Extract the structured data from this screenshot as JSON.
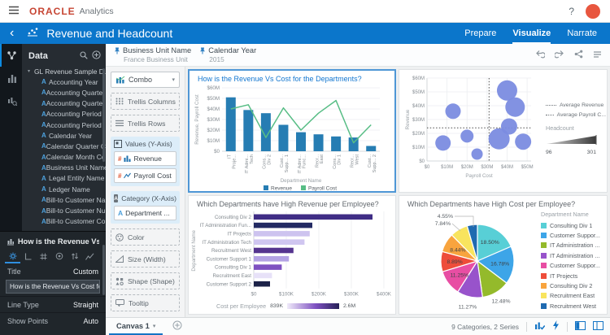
{
  "app_bar": {
    "brand": "ORACLE",
    "product": "Analytics",
    "help_label": "?"
  },
  "title_bar": {
    "title": "Revenue and Headcount",
    "tabs": [
      {
        "label": "Prepare"
      },
      {
        "label": "Visualize"
      },
      {
        "label": "Narrate"
      }
    ]
  },
  "data_panel": {
    "title": "Data",
    "dataset": "GL Revenue Sample D...",
    "fields": [
      "Accounting Year",
      "Accounting Quarter ...",
      "Accounting Quarter ...",
      "Accounting Period ...",
      "Accounting Period ...",
      "Calendar Year",
      "Calendar Quarter C...",
      "Calendar Month Co...",
      "Business Unit Name",
      "Legal Entity Name",
      "Ledger Name",
      "Bill-to Customer Na...",
      "Bill-to Customer Nu...",
      "Bill-to Customer Co..."
    ]
  },
  "properties_panel": {
    "title": "How is the Revenue Vs Co...",
    "title_label": "Title",
    "title_value": "Custom",
    "title_input": "How is the Revenue Vs Cost for the",
    "line_type_label": "Line Type",
    "line_type_value": "Straight",
    "show_points_label": "Show Points",
    "show_points_value": "Auto"
  },
  "filters": [
    {
      "name": "Business Unit Name",
      "value": "France Business Unit"
    },
    {
      "name": "Calendar Year",
      "value": "2015"
    }
  ],
  "grammar_panel": {
    "chart_type": "Combo",
    "trellis_columns": "Trellis Columns",
    "trellis_rows": "Trellis Rows",
    "values_label": "Values (Y-Axis)",
    "value_items": [
      "Revenue",
      "Payroll Cost"
    ],
    "category_label": "Category (X-Axis)",
    "category_item": "Department ...",
    "extra_zones": [
      "Color",
      "Size (Width)",
      "Shape (Shape)",
      "Tooltip"
    ]
  },
  "status_bar": {
    "canvas_tab": "Canvas 1",
    "summary": "9 Categories, 2 Series"
  },
  "colors": {
    "accent_blue": "#0b76cb",
    "oracle_red": "#c74634",
    "selected_tile_border": "#4f97d6",
    "bar_revenue": "#267db3",
    "line_payroll": "#57bd85",
    "bubble": "#7b8ce0"
  },
  "chart_data": [
    {
      "type": "combo",
      "title": "How is the Revenue Vs Cost for the Departments?",
      "categories": [
        [
          "IT",
          "Proje..."
        ],
        [
          "IT Admi...",
          "Tech"
        ],
        [
          "Cons...",
          "Div 2"
        ],
        [
          "Cust...",
          "Supp... 1"
        ],
        [
          "IT Admi...",
          "Func..."
        ],
        [
          "Recr...",
          "East"
        ],
        [
          "Cons...",
          "Div 1"
        ],
        [
          "Recr...",
          "West"
        ],
        [
          "Cust...",
          "Supp... 2"
        ]
      ],
      "series": [
        {
          "name": "Revenue",
          "type": "bar",
          "color": "#267db3",
          "values_m": [
            51,
            39,
            36,
            25,
            18,
            16,
            14,
            13,
            5
          ]
        },
        {
          "name": "Payroll Cost",
          "type": "line",
          "color": "#57bd85",
          "values_m": [
            40,
            44,
            13,
            41,
            20,
            36,
            48,
            8,
            25
          ]
        }
      ],
      "xlabel": "Department Name",
      "ylabel": "Revenue, Payroll Cost",
      "yticks": [
        "$0",
        "$10M",
        "$20M",
        "$30M",
        "$40M",
        "$50M",
        "$60M"
      ],
      "ylim": [
        0,
        60
      ]
    },
    {
      "type": "scatter",
      "points": [
        {
          "x": 40,
          "y": 51,
          "r": 12.5
        },
        {
          "x": 44,
          "y": 39,
          "r": 12
        },
        {
          "x": 13,
          "y": 36,
          "r": 9.5
        },
        {
          "x": 41,
          "y": 25,
          "r": 10
        },
        {
          "x": 20,
          "y": 18,
          "r": 8
        },
        {
          "x": 36,
          "y": 16,
          "r": 13
        },
        {
          "x": 48,
          "y": 14,
          "r": 10
        },
        {
          "x": 8,
          "y": 13,
          "r": 9.5
        },
        {
          "x": 25,
          "y": 5,
          "r": 7
        }
      ],
      "color": "#7b8ce0",
      "xlabel": "Payroll Cost",
      "ylabel": "Revenue",
      "xticks": [
        "$0",
        "$10M",
        "$20M",
        "$30M",
        "$40M",
        "$50M"
      ],
      "yticks": [
        "$0",
        "$10M",
        "$20M",
        "$30M",
        "$40M",
        "$50M",
        "$60M"
      ],
      "xlim": [
        0,
        52
      ],
      "ylim": [
        0,
        60
      ],
      "avg_revenue": 24,
      "avg_payroll": 31,
      "legend": [
        "Average Revenue",
        "Average Payroll C..."
      ],
      "size_legend": {
        "title": "Headcount",
        "min": "96",
        "max": "301"
      }
    },
    {
      "type": "bar-horizontal",
      "title": "Which Departments have High Revenue per Employee?",
      "categories": [
        "Consulting Div 2",
        "IT Administration Fun...",
        "IT Projects",
        "IT Administration Tech",
        "Recruitment West",
        "Customer Support 1",
        "Consulting Div 1",
        "Recruitment East",
        "Customer Support 2"
      ],
      "values_k": [
        365,
        180,
        172,
        156,
        122,
        108,
        86,
        56,
        50
      ],
      "colors": [
        "#3f2d85",
        "#232a63",
        "#cdc3ef",
        "#d0c6f0",
        "#55348f",
        "#b3a2e4",
        "#7e51c1",
        "#e7e1f8",
        "#1c2248"
      ],
      "xlabel": "Revenue per Employee",
      "ylabel": "Department Name",
      "xticks": [
        "$0",
        "$100K",
        "$200K",
        "$300K",
        "$400K"
      ],
      "xlim": [
        0,
        400
      ],
      "gradient_legend": {
        "title": "Cost per Employee",
        "min": "839K",
        "max": "2.6M",
        "from": "#f0ebfa",
        "mid": "#7e51c1",
        "to": "#262057"
      }
    },
    {
      "type": "pie",
      "title": "Which Departments have High Cost per Employee?",
      "legend_title": "Department Name",
      "slices": [
        {
          "label": "Consulting Div 1",
          "pct": 18.5,
          "display": "18.50%",
          "color": "#58cfd6",
          "label_pos": "in"
        },
        {
          "label": "Customer Suppor...",
          "pct": 16.78,
          "display": "16.78%",
          "color": "#3da5e8",
          "label_pos": "in"
        },
        {
          "label": "IT Administration ...",
          "pct": 12.48,
          "display": "12.48%",
          "color": "#94ba2b",
          "label_pos": "out"
        },
        {
          "label": "IT Administration ...",
          "pct": 11.27,
          "display": "11.27%",
          "color": "#9853cb",
          "label_pos": "out"
        },
        {
          "label": "Customer Suppor...",
          "pct": 11.25,
          "display": "11.25%",
          "color": "#e84ea3",
          "label_pos": "in"
        },
        {
          "label": "IT Projects",
          "pct": 8.89,
          "display": "8.89%",
          "color": "#ee4d3a",
          "label_pos": "in"
        },
        {
          "label": "Consulting Div 2",
          "pct": 8.44,
          "display": "8.44%",
          "color": "#f8a43e",
          "label_pos": "in"
        },
        {
          "label": "Recruitment East",
          "pct": 7.84,
          "display": "7.84%",
          "color": "#f8e45e",
          "label_pos": "callout"
        },
        {
          "label": "Recruitment West",
          "pct": 4.55,
          "display": "4.55%",
          "color": "#1f6ab0",
          "label_pos": "callout"
        }
      ]
    }
  ]
}
